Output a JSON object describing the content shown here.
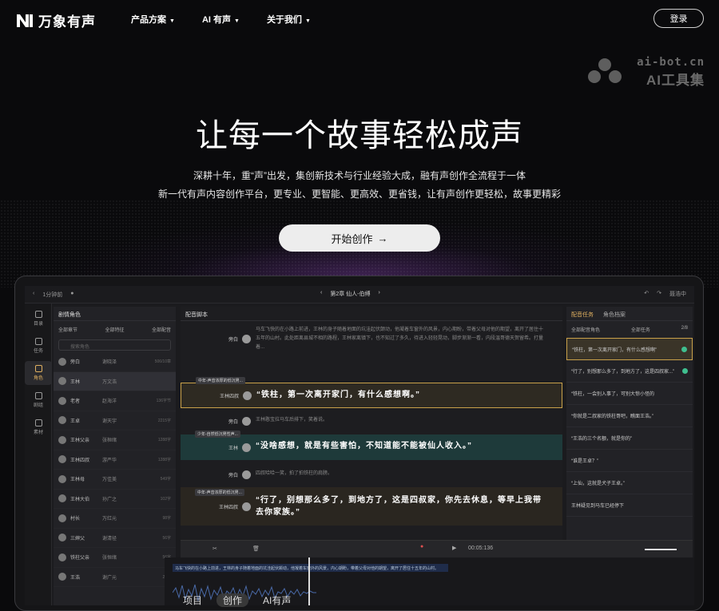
{
  "brand": {
    "name": "万象有声"
  },
  "nav": {
    "items": [
      {
        "label": "产品方案"
      },
      {
        "label": "AI 有声"
      },
      {
        "label": "关于我们"
      }
    ],
    "login": "登录"
  },
  "watermark": {
    "line1": "ai-bot.cn",
    "line2": "AI工具集"
  },
  "hero": {
    "title": "让每一个故事轻松成声",
    "sub1": "深耕十年，重“声”出发，集创新技术与行业经验大成，融有声创作全流程于一体",
    "sub2": "新一代有声内容创作平台，更专业、更智能、更高效、更省钱，让有声创作更轻松，故事更精彩",
    "cta": "开始创作"
  },
  "app": {
    "topbar": {
      "back": "‹",
      "status": "1分钟前",
      "chapter": "第2章 仙人-伯缚",
      "user": "聂浩中"
    },
    "rail": [
      {
        "label": "目录"
      },
      {
        "label": "任务"
      },
      {
        "label": "角色"
      },
      {
        "label": "剧组"
      },
      {
        "label": "素材"
      }
    ],
    "left_panel": {
      "title": "剧情角色",
      "filters": [
        "全部章节",
        "全部特征",
        "全部配音"
      ],
      "search_placeholder": "搜索角色",
      "characters": [
        {
          "name": "旁白",
          "actor": "谢晓泽",
          "count": "506/10章"
        },
        {
          "name": "王林",
          "actor": "万文浩",
          "count": ""
        },
        {
          "name": "老者",
          "actor": "赵海洋",
          "count": "136字节"
        },
        {
          "name": "王卓",
          "actor": "谢天宇",
          "count": "2215字"
        },
        {
          "name": "王林父亲",
          "actor": "张桓绪",
          "count": "1288字"
        },
        {
          "name": "王林四叔",
          "actor": "游严华",
          "count": "1288字"
        },
        {
          "name": "王林母",
          "actor": "万佳美",
          "count": "549字"
        },
        {
          "name": "王林大伯",
          "actor": "孙广之",
          "count": "102字"
        },
        {
          "name": "村长",
          "actor": "万红元",
          "count": "98字"
        },
        {
          "name": "三婶父",
          "actor": "谢清径",
          "count": "56字"
        },
        {
          "name": "铁柱父亲",
          "actor": "张恒绪",
          "count": "56字"
        },
        {
          "name": "王浩",
          "actor": "谢广元",
          "count": "22字"
        }
      ]
    },
    "main_panel": {
      "title": "配音脚本",
      "lines": [
        {
          "speaker": "旁白",
          "text": "马车飞快的在小路上前进，王林的身子随着地面的坑洼起伏颠动，他凝着车窗外的风景，内心期盼，带着父母对他的期望，离开了居住十五年的山村。此处距离县城不相的路程，王林家离镇下，也不知过了多久，待进入轻轻晃动，脚步渐渐一看，内段温哥德天贺留希。打量着..."
        },
        {
          "speaker": "王林四叔",
          "tag": "中年-声音浓厚的低沉男...",
          "text": "“铁柱，第一次离开家门，有什么感想啊。”"
        },
        {
          "speaker": "旁白",
          "text": "王林憨宝拉马车后排下，笑着说。"
        },
        {
          "speaker": "王林",
          "tag": "少年-自然低沉男性声...",
          "text": "“没啥感想，就是有些害怕，不知道能不能被仙人收入。”"
        },
        {
          "speaker": "旁白",
          "text": "四叔哈哈一笑，拍了拍铁柱的肩膀。"
        },
        {
          "speaker": "王林四叔",
          "tag": "中年-声音浓厚的低沉男...",
          "text": "“行了，别想那么多了，到地方了，这是四叔家，你先去休息，等早上我带去你家族。”"
        }
      ]
    },
    "right_panel": {
      "tabs": [
        "配音任务",
        "角色档案"
      ],
      "filters": [
        "全部配音角色",
        "全部任务",
        "2/8"
      ],
      "items": [
        "“铁柱，第一次离开家门，有什么感想啊”",
        "“行了，别想那么多了，到地方了，这是四叔家...”",
        "“铁柱，一会别入事了，可别大惊小怪的",
        "“你就是二叔家的铁柱哥吧，瞧面王浩。”",
        "“王浩的三个名额，就是你的”",
        "“谁是王卓？”",
        "“上仙，这就是犬子王卓。”",
        "王林疑见到马车已经停下"
      ]
    },
    "toolbar": {
      "time": "00:05:136"
    },
    "timeline": {
      "text": "马车飞快的在小路上前进，王林的身子随着地面的坑洼起伏颠动，他凝着车窗外的风景，内心期盼，带着父母对他的期望，离开了居住十五年的山村。"
    },
    "float_tabs": [
      "项目",
      "创作",
      "AI有声"
    ]
  }
}
